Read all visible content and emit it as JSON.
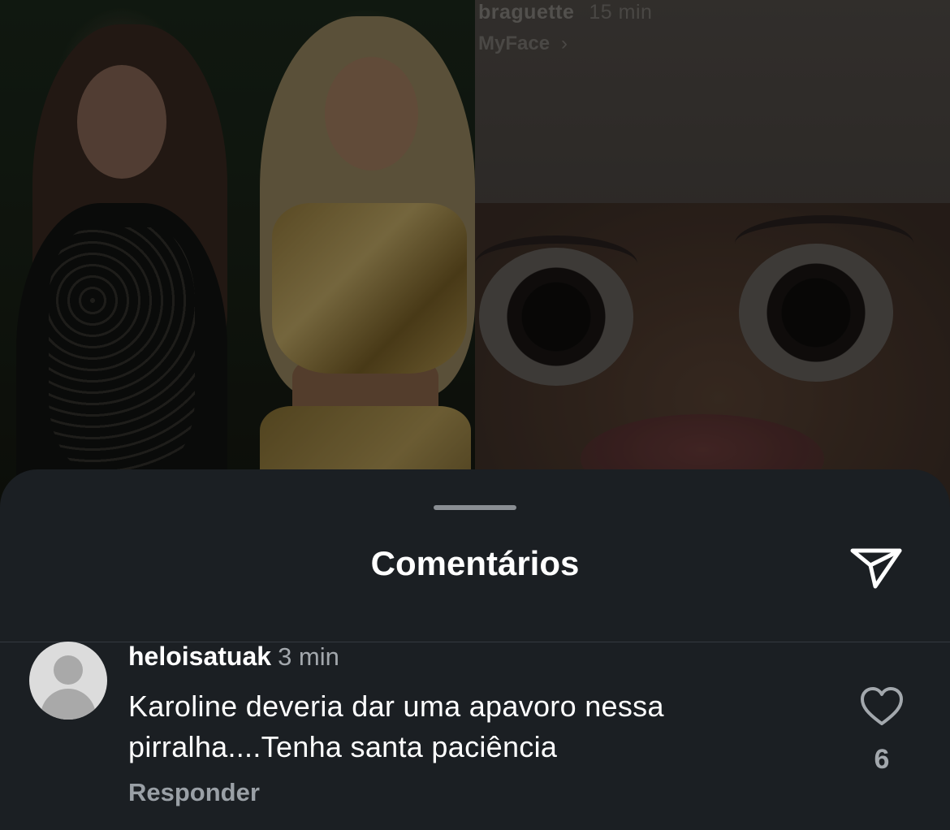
{
  "background_post": {
    "story_username": "braguette",
    "story_time": "15 min",
    "story_filter": "MyFace",
    "story_filter_chevron": "›"
  },
  "sheet": {
    "title": "Comentários",
    "share_icon": "paper-plane-icon"
  },
  "comment": {
    "username": "heloisatuak",
    "time": "3 min",
    "text": "Karoline deveria dar uma apavoro nessa pirralha....Tenha santa paciência",
    "reply_label": "Responder",
    "like_count": "6",
    "like_icon": "heart-outline-icon"
  },
  "colors": {
    "sheet_background": "#1b1f23",
    "primary_text": "#ffffff",
    "secondary_text": "#a3a8ad",
    "avatar_background": "#dcdcdc"
  }
}
